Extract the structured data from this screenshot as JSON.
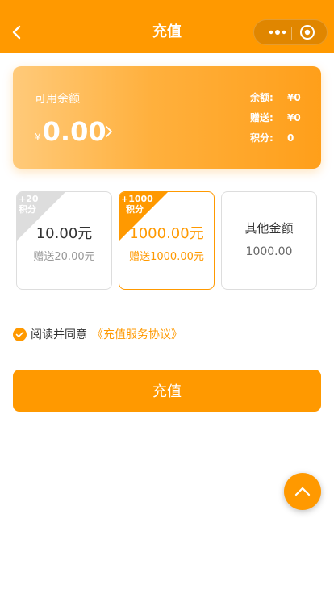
{
  "nav": {
    "title": "充值",
    "back_icon": "chevron-left-icon",
    "more_icon": "more-dots-icon",
    "close_icon": "target-icon"
  },
  "balance_card": {
    "label": "可用余额",
    "currency": "¥",
    "amount": "0.00",
    "stats": [
      {
        "key": "余额:",
        "value": "¥0"
      },
      {
        "key": "赠送:",
        "value": "¥0"
      },
      {
        "key": "积分:",
        "value": "0"
      }
    ]
  },
  "options": [
    {
      "ribbon_line1": "+20",
      "ribbon_line2": "积分",
      "amount": "10.00元",
      "bonus": "赠送20.00元",
      "selected": false
    },
    {
      "ribbon_line1": "+1000",
      "ribbon_line2": "积分",
      "amount": "1000.00元",
      "bonus": "赠送1000.00元",
      "selected": true
    },
    {
      "label": "其他金额",
      "value": "1000.00",
      "selected": false
    }
  ],
  "agreement": {
    "text": "阅读并同意",
    "link": "《充值服务协议》",
    "checked": true
  },
  "submit_label": "充值",
  "colors": {
    "accent": "#ff9900",
    "border": "#dddddd"
  }
}
